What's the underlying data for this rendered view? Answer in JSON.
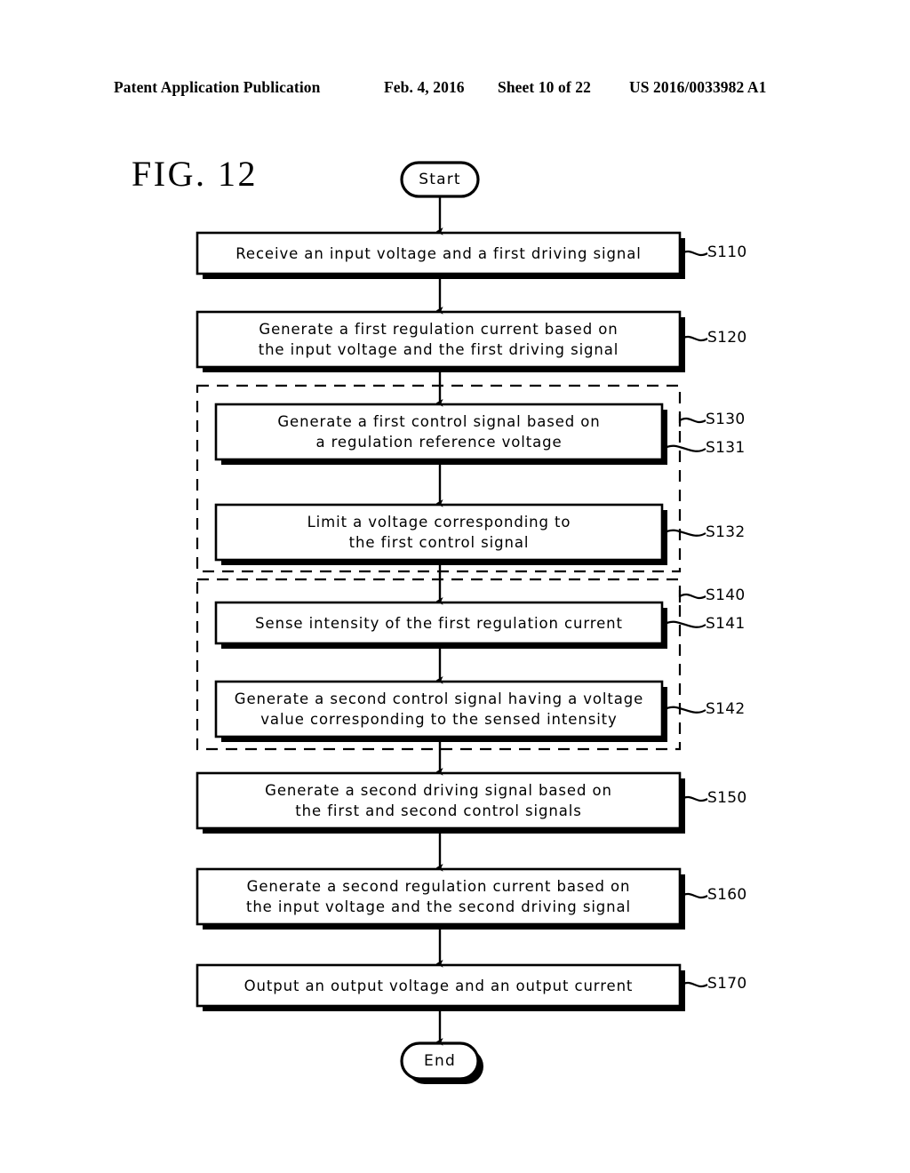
{
  "header": {
    "publication": "Patent Application Publication",
    "date": "Feb. 4, 2016",
    "sheet": "Sheet 10 of 22",
    "patent_number": "US 2016/0033982 A1"
  },
  "figure": {
    "title": "FIG. 12",
    "type": "flowchart"
  },
  "flowchart": {
    "start_label": "Start",
    "end_label": "End",
    "steps": [
      {
        "id": "S110",
        "label": "S110",
        "text": "Receive an input voltage and a first driving signal",
        "shape": "process",
        "lines": 1
      },
      {
        "id": "S120",
        "label": "S120",
        "text": "Generate a first regulation current based on\nthe input voltage and the first driving signal",
        "shape": "process",
        "lines": 2
      },
      {
        "id": "S131",
        "label": "S131",
        "text": "Generate a first control signal based on\na regulation reference voltage",
        "shape": "process",
        "lines": 2
      },
      {
        "id": "S132",
        "label": "S132",
        "text": "Limit a voltage corresponding to\nthe first control signal",
        "shape": "process",
        "lines": 2
      },
      {
        "id": "S141",
        "label": "S141",
        "text": "Sense intensity of the first regulation current",
        "shape": "process",
        "lines": 1
      },
      {
        "id": "S142",
        "label": "S142",
        "text": "Generate a second control signal having a voltage\nvalue corresponding to the sensed intensity",
        "shape": "process",
        "lines": 2
      },
      {
        "id": "S150",
        "label": "S150",
        "text": "Generate a second driving signal based on\nthe first and second control signals",
        "shape": "process",
        "lines": 2
      },
      {
        "id": "S160",
        "label": "S160",
        "text": "Generate a second regulation current based on\nthe input voltage and the second driving signal",
        "shape": "process",
        "lines": 2
      },
      {
        "id": "S170",
        "label": "S170",
        "text": "Output an output voltage and an output current",
        "shape": "process",
        "lines": 1
      }
    ],
    "groups": [
      {
        "id": "S130",
        "label": "S130",
        "style": "dashed",
        "contains": [
          "S131",
          "S132"
        ]
      },
      {
        "id": "S140",
        "label": "S140",
        "style": "dashed",
        "contains": [
          "S141",
          "S142"
        ]
      }
    ],
    "flow_order": [
      "Start",
      "S110",
      "S120",
      "S131",
      "S132",
      "S141",
      "S142",
      "S150",
      "S160",
      "S170",
      "End"
    ],
    "colors": {
      "stroke": "#000000",
      "fill": "#ffffff",
      "background": "#ffffff"
    }
  }
}
